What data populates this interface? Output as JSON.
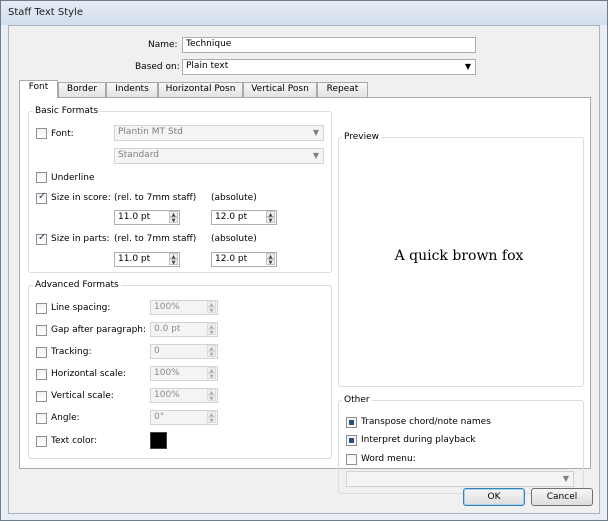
{
  "window": {
    "title": "Staff Text Style"
  },
  "name_field": {
    "label": "Name:",
    "value": "Technique"
  },
  "based_on": {
    "label": "Based on:",
    "value": "Plain text"
  },
  "tabs": [
    {
      "label": "Font"
    },
    {
      "label": "Border"
    },
    {
      "label": "Indents"
    },
    {
      "label": "Horizontal Posn"
    },
    {
      "label": "Vertical Posn"
    },
    {
      "label": "Repeat"
    }
  ],
  "basic": {
    "title": "Basic Formats",
    "font_label": "Font:",
    "font_value": "Plantin MT Std",
    "style_value": "Standard",
    "underline_label": "Underline",
    "size_score_label": "Size in score:",
    "size_parts_label": "Size in parts:",
    "rel_label": "(rel. to 7mm staff)",
    "abs_label": "(absolute)",
    "score_rel": "11.0 pt",
    "score_abs": "12.0 pt",
    "parts_rel": "11.0 pt",
    "parts_abs": "12.0 pt"
  },
  "advanced": {
    "title": "Advanced Formats",
    "line_spacing_label": "Line spacing:",
    "line_spacing_value": "100%",
    "gap_label": "Gap after paragraph:",
    "gap_value": "0.0 pt",
    "tracking_label": "Tracking:",
    "tracking_value": "0",
    "hscale_label": "Horizontal scale:",
    "hscale_value": "100%",
    "vscale_label": "Vertical scale:",
    "vscale_value": "100%",
    "angle_label": "Angle:",
    "angle_value": "0°",
    "color_label": "Text color:",
    "color_value": "#000000"
  },
  "preview": {
    "title": "Preview",
    "sample": "A quick brown fox"
  },
  "other": {
    "title": "Other",
    "transpose_label": "Transpose chord/note names",
    "interpret_label": "Interpret during playback",
    "word_menu_label": "Word menu:",
    "word_menu_value": ""
  },
  "buttons": {
    "ok": "OK",
    "cancel": "Cancel"
  }
}
